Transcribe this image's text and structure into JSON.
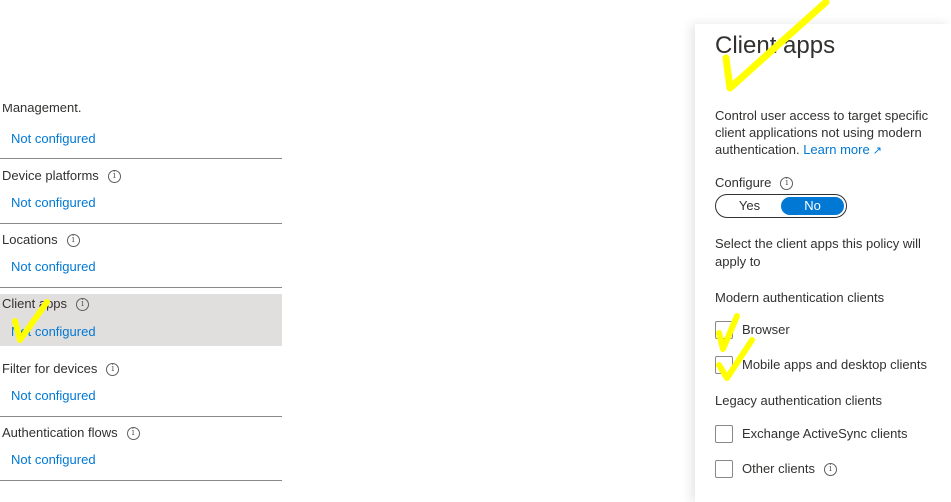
{
  "conditions": {
    "cutoff_label": "Management.",
    "cutoff_value": "Not configured",
    "items": [
      {
        "title": "Device platforms",
        "value": "Not configured"
      },
      {
        "title": "Locations",
        "value": "Not configured"
      },
      {
        "title": "Client apps",
        "value": "Not configured"
      },
      {
        "title": "Filter for devices",
        "value": "Not configured"
      },
      {
        "title": "Authentication flows",
        "value": "Not configured"
      }
    ]
  },
  "panel": {
    "title": "Client apps",
    "description": "Control user access to target specific client applications not using modern authentication.",
    "learn_more": "Learn more",
    "configure_label": "Configure",
    "toggle": {
      "yes": "Yes",
      "no": "No",
      "selected": "No"
    },
    "select_text": "Select the client apps this policy will apply to",
    "modern_heading": "Modern authentication clients",
    "modern_options": [
      {
        "label": "Browser",
        "checked": false
      },
      {
        "label": "Mobile apps and desktop clients",
        "checked": false
      }
    ],
    "legacy_heading": "Legacy authentication clients",
    "legacy_options": [
      {
        "label": "Exchange ActiveSync clients",
        "checked": false
      },
      {
        "label": "Other clients",
        "checked": false
      }
    ]
  },
  "colors": {
    "link": "#0078d4",
    "toggle_active": "#0078d4",
    "selected_row": "#e1dfdd",
    "annotation": "#ffff00"
  },
  "icons": [
    "info-icon",
    "external-link-icon",
    "checkmark-annotation"
  ]
}
